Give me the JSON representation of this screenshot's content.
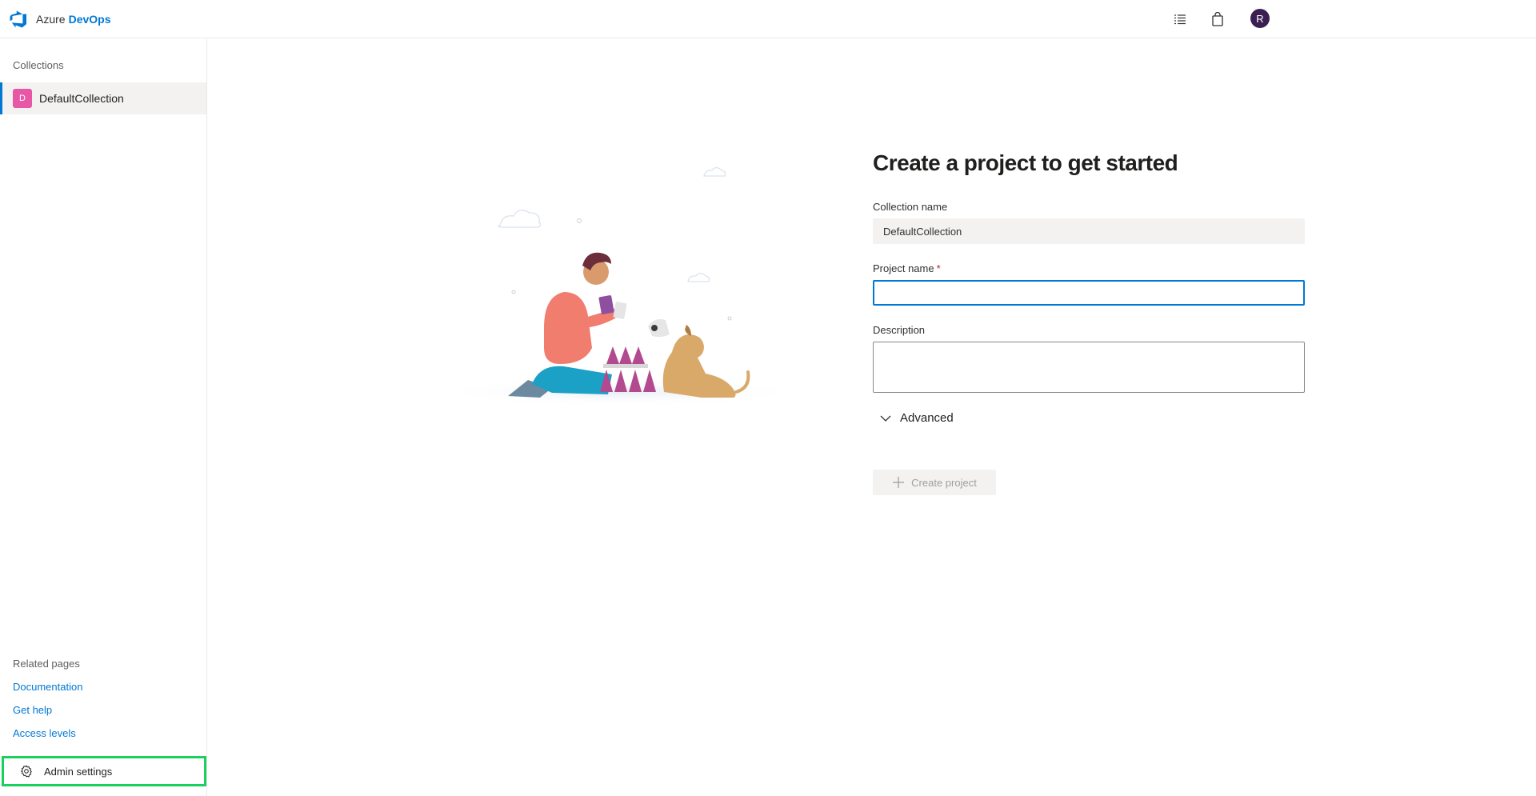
{
  "header": {
    "brand_prefix": "Azure",
    "brand_accent": "DevOps",
    "avatar_initial": "R",
    "icons": [
      "azure-devops-logo-icon",
      "work-items-list-icon",
      "marketplace-bag-icon"
    ]
  },
  "sidebar": {
    "collections_heading": "Collections",
    "collections": [
      {
        "badge": "D",
        "label": "DefaultCollection",
        "selected": true
      }
    ],
    "related_heading": "Related pages",
    "related_links": [
      "Documentation",
      "Get help",
      "Access levels"
    ],
    "admin_label": "Admin settings"
  },
  "main": {
    "title": "Create a project to get started",
    "collection_label": "Collection name",
    "collection_value": "DefaultCollection",
    "project_label": "Project name",
    "required_marker": "*",
    "project_value": "",
    "description_label": "Description",
    "description_value": "",
    "advanced_label": "Advanced",
    "create_button_label": "Create project"
  },
  "colors": {
    "accent": "#0078d4",
    "badge": "#e857a6",
    "avatar": "#3b1f53",
    "highlight_border": "#1ad05e",
    "required": "#a4262c"
  }
}
